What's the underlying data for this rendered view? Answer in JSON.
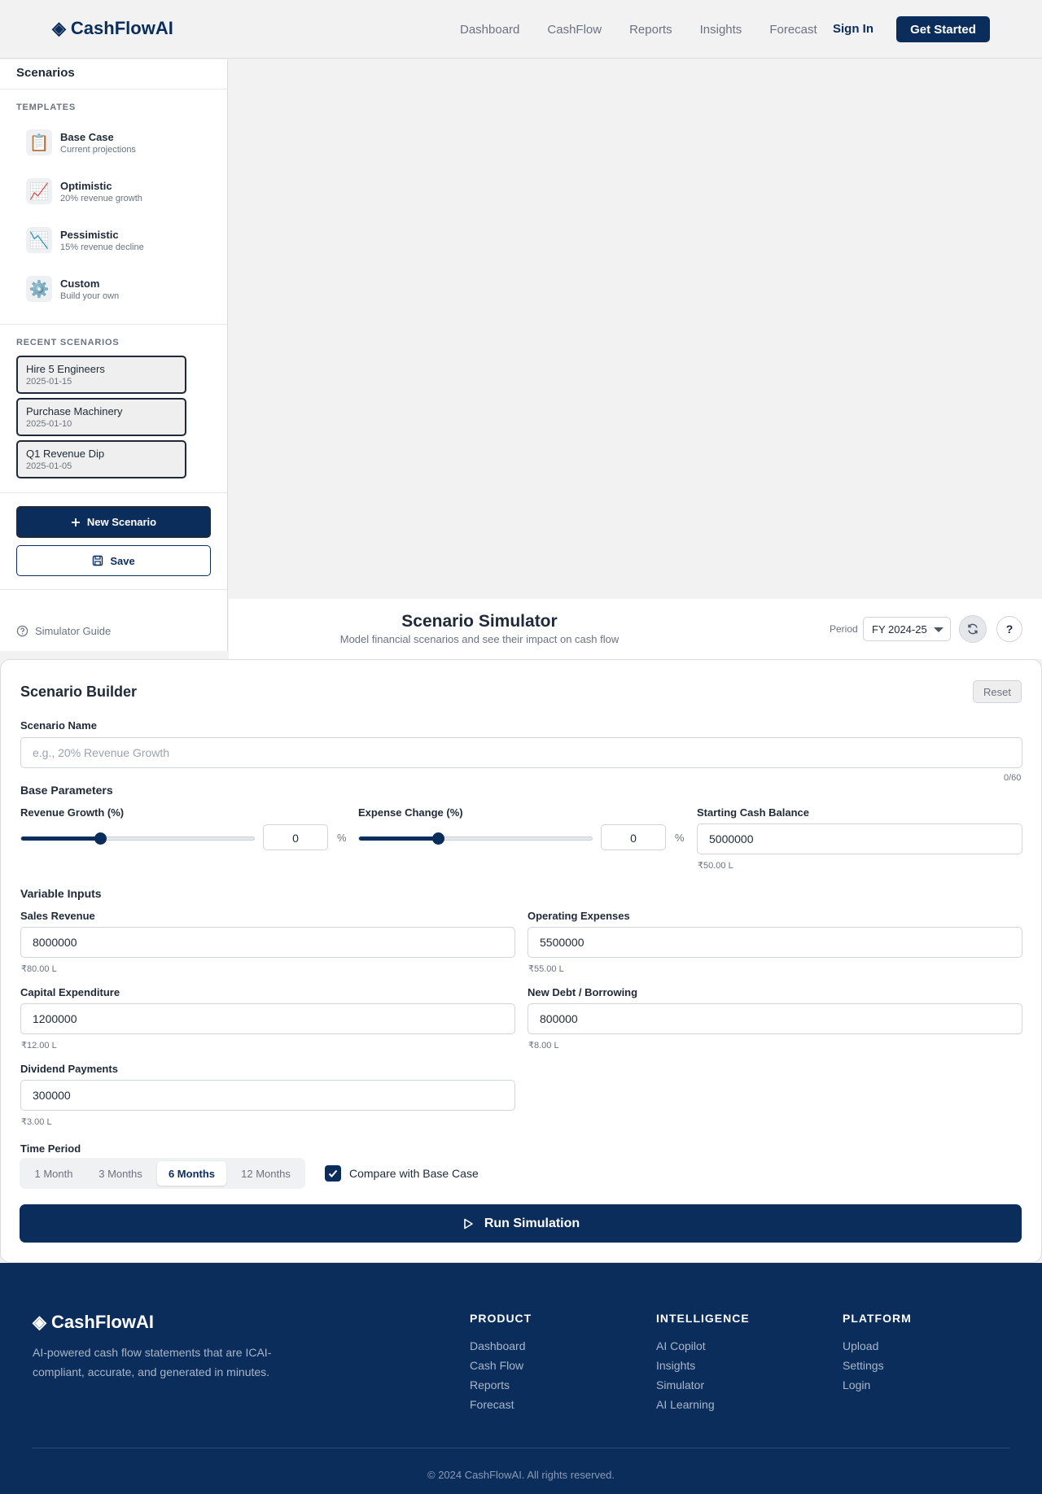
{
  "nav": {
    "logo": "CashFlowAI",
    "links": [
      "Dashboard",
      "CashFlow",
      "Reports",
      "Insights",
      "Forecast"
    ],
    "signin": "Sign In",
    "get_started": "Get Started"
  },
  "sidebar": {
    "title": "Scenarios",
    "templates_heading": "TEMPLATES",
    "templates": [
      {
        "name": "Base Case",
        "desc": "Current projections",
        "icon": "clipboard-icon"
      },
      {
        "name": "Optimistic",
        "desc": "20% revenue growth",
        "icon": "chart-up-icon"
      },
      {
        "name": "Pessimistic",
        "desc": "15% revenue decline",
        "icon": "chart-down-icon"
      },
      {
        "name": "Custom",
        "desc": "Build your own",
        "icon": "gear-icon"
      }
    ],
    "recent_heading": "RECENT SCENARIOS",
    "recent": [
      {
        "name": "Hire 5 Engineers",
        "date": "2025-01-15"
      },
      {
        "name": "Purchase Machinery",
        "date": "2025-01-10"
      },
      {
        "name": "Q1 Revenue Dip",
        "date": "2025-01-05"
      }
    ],
    "new_scenario": "New Scenario",
    "save": "Save",
    "guide": "Simulator Guide"
  },
  "header": {
    "title": "Scenario Simulator",
    "subtitle": "Model financial scenarios and see their impact on cash flow",
    "period_label": "Period",
    "period_value": "FY 2024-25",
    "help": "?"
  },
  "builder": {
    "title": "Scenario Builder",
    "reset": "Reset",
    "scenario_name_label": "Scenario Name",
    "scenario_name_placeholder": "e.g., 20% Revenue Growth",
    "scenario_name_counter": "0/60",
    "base_params_heading": "Base Parameters",
    "revenue_growth": {
      "label": "Revenue Growth (%)",
      "value": "0",
      "unit": "%",
      "slider_fraction": 0.34
    },
    "expense_change": {
      "label": "Expense Change (%)",
      "value": "0",
      "unit": "%",
      "slider_fraction": 0.34
    },
    "starting_cash": {
      "label": "Starting Cash Balance",
      "value": "5000000",
      "hint": "₹50.00 L"
    },
    "variable_heading": "Variable Inputs",
    "sales_revenue": {
      "label": "Sales Revenue",
      "value": "8000000",
      "hint": "₹80.00 L"
    },
    "operating_expenses": {
      "label": "Operating Expenses",
      "value": "5500000",
      "hint": "₹55.00 L"
    },
    "capital_expenditure": {
      "label": "Capital Expenditure",
      "value": "1200000",
      "hint": "₹12.00 L"
    },
    "new_debt": {
      "label": "New Debt / Borrowing",
      "value": "800000",
      "hint": "₹8.00 L"
    },
    "dividend": {
      "label": "Dividend Payments",
      "value": "300000",
      "hint": "₹3.00 L"
    },
    "time_period_label": "Time Period",
    "time_options": [
      "1 Month",
      "3 Months",
      "6 Months",
      "12 Months"
    ],
    "time_selected": "6 Months",
    "compare_label": "Compare with Base Case",
    "compare_checked": true,
    "run": "Run Simulation"
  },
  "footer": {
    "logo": "CashFlowAI",
    "desc": "AI-powered cash flow statements that are ICAI-compliant, accurate, and generated in minutes.",
    "columns": [
      {
        "heading": "PRODUCT",
        "links": [
          "Dashboard",
          "Cash Flow",
          "Reports",
          "Forecast"
        ]
      },
      {
        "heading": "INTELLIGENCE",
        "links": [
          "AI Copilot",
          "Insights",
          "Simulator",
          "AI Learning"
        ]
      },
      {
        "heading": "PLATFORM",
        "links": [
          "Upload",
          "Settings",
          "Login"
        ]
      }
    ],
    "copyright": "© 2024 CashFlowAI. All rights reserved."
  },
  "colors": {
    "brand": "#0b2d5b",
    "background": "#f2f2f2"
  }
}
